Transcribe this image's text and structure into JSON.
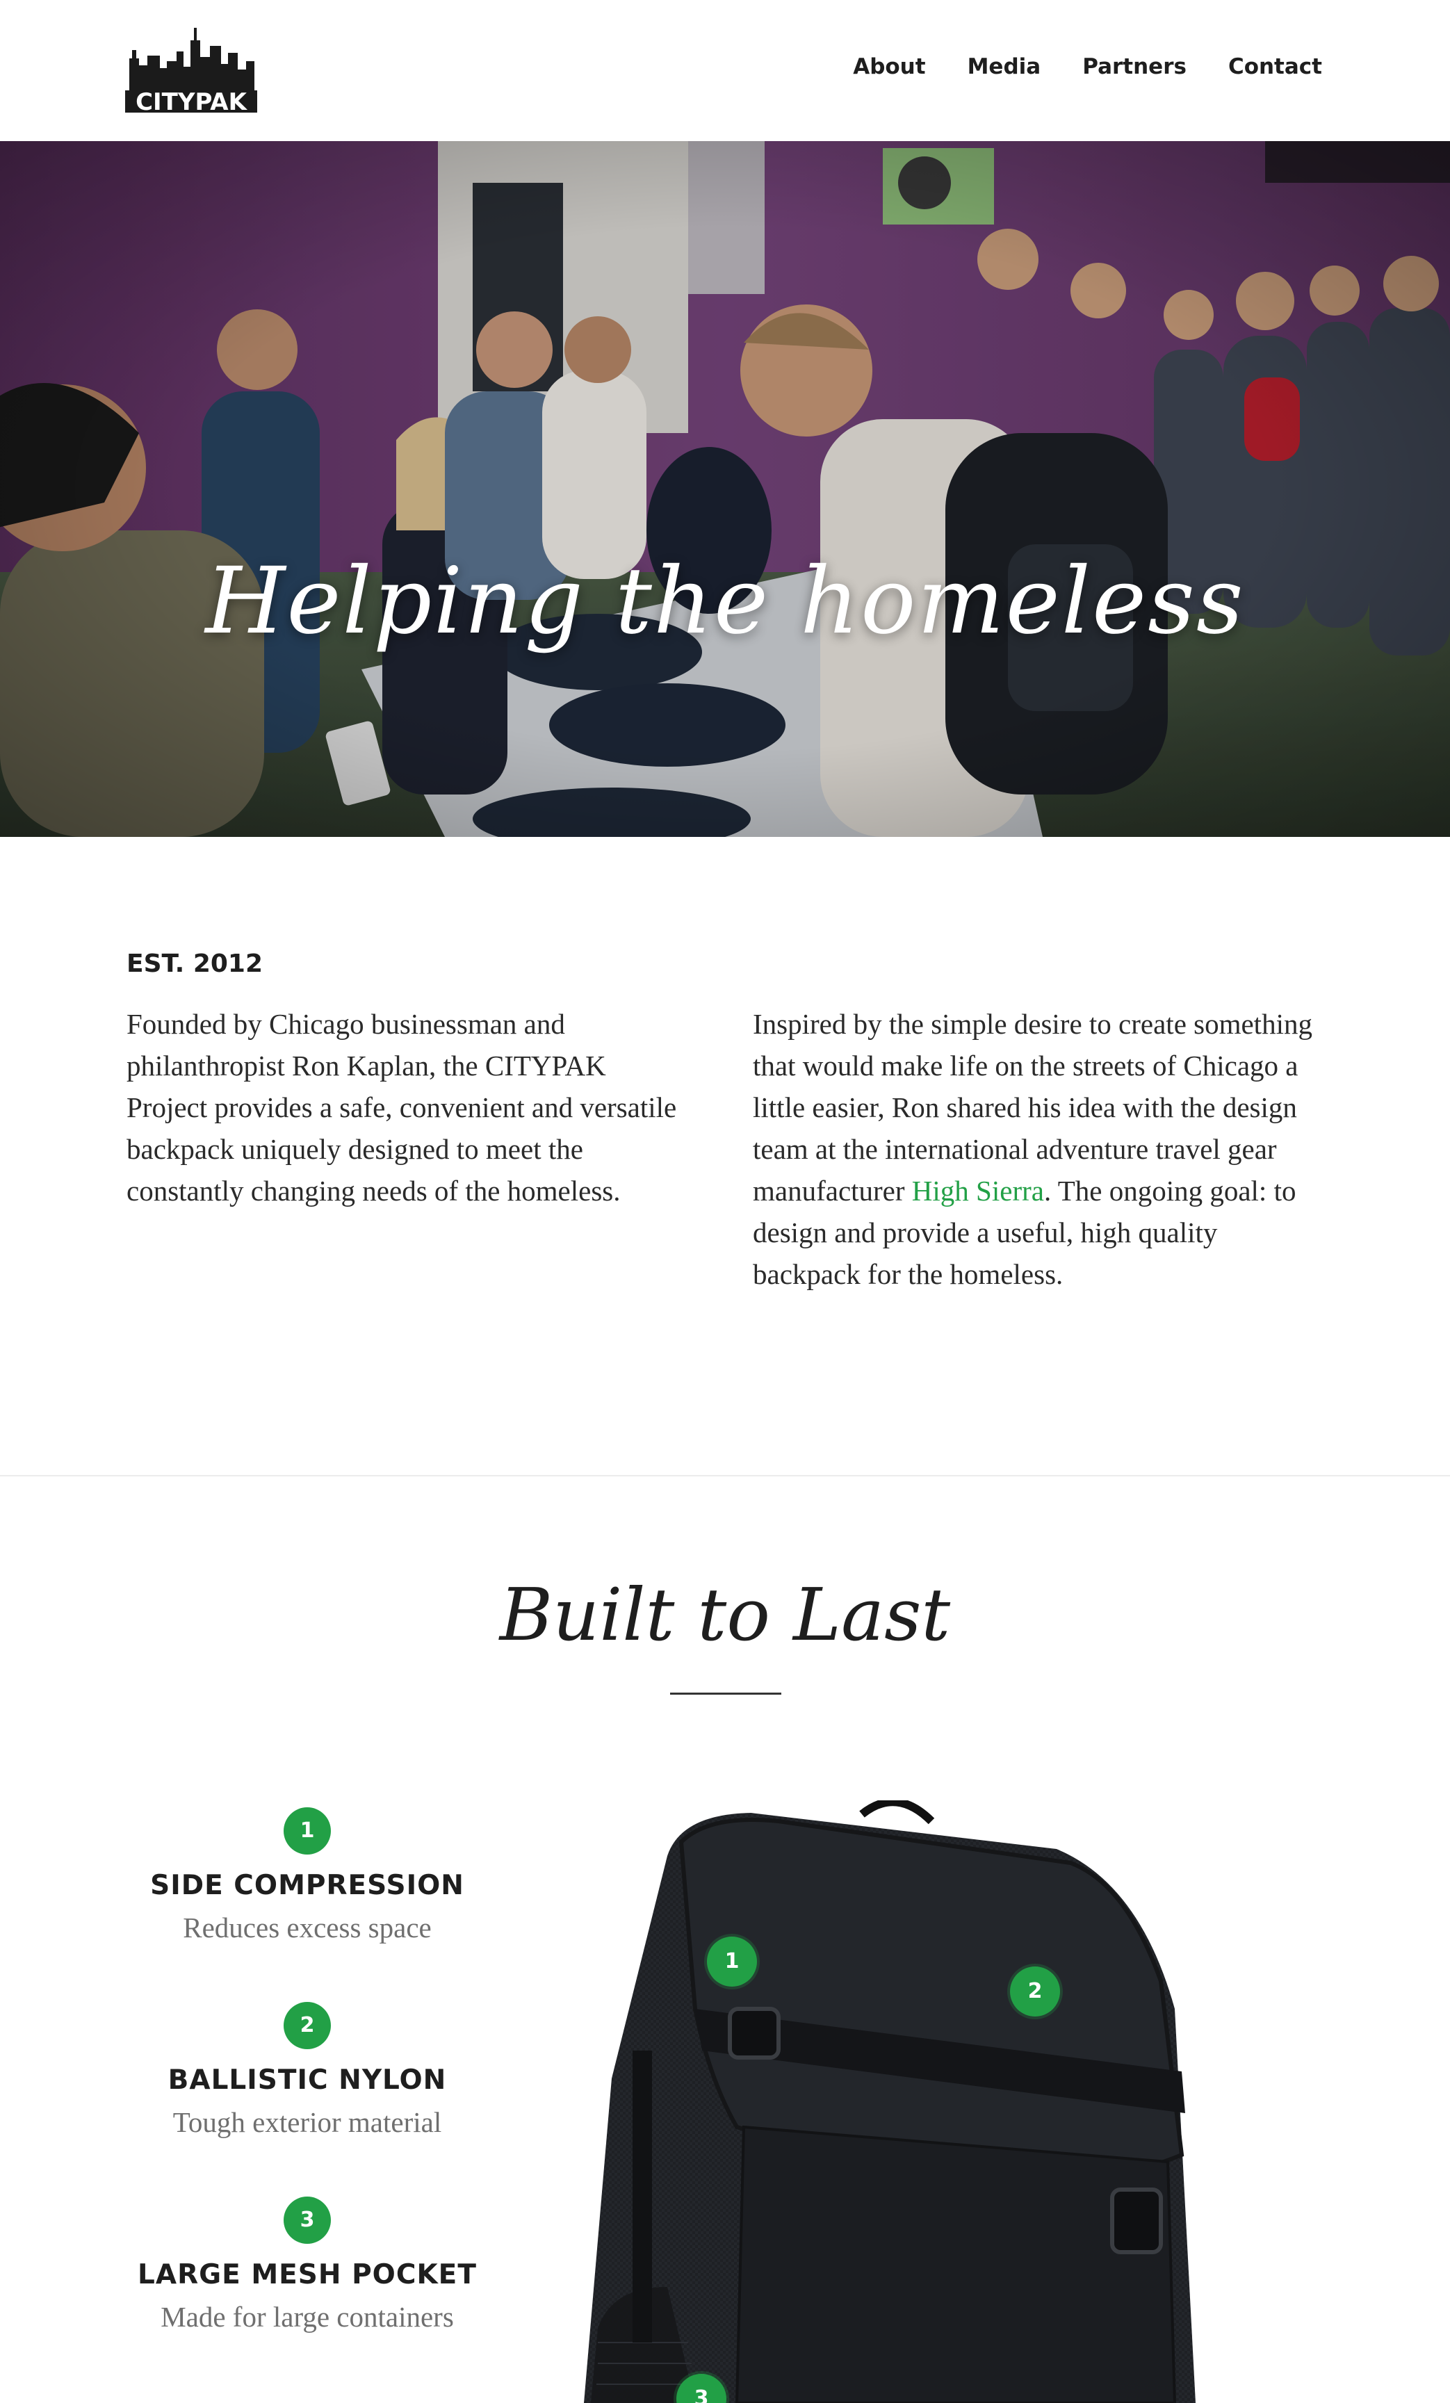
{
  "header": {
    "logo_text": "CITYPAK",
    "nav": [
      "About",
      "Media",
      "Partners",
      "Contact"
    ]
  },
  "hero": {
    "title": "Helping the homeless",
    "image": "photo of volunteers handing out backpacks to homeless people in a purple-walled room"
  },
  "intro": {
    "est": "EST. 2012",
    "left_paragraph": "Founded by Chicago businessman and philanthropist Ron Kaplan, the CITYPAK Project provides a safe, convenient and versatile backpack uniquely designed to meet the constantly changing needs of the homeless.",
    "right_before_link": "Inspired by the simple desire to create something that would make life on the streets of Chicago a little easier, Ron shared his idea with the design team at the international adventure travel gear manufacturer ",
    "right_link": "High Sierra",
    "right_after_link": ". The ongoing goal: to design and provide a useful, high quality backpack for the homeless."
  },
  "built": {
    "title": "Built to Last",
    "features": [
      {
        "num": "1",
        "title": "SIDE COMPRESSION",
        "desc": "Reduces excess space"
      },
      {
        "num": "2",
        "title": "BALLISTIC NYLON",
        "desc": "Tough exterior material"
      },
      {
        "num": "3",
        "title": "LARGE MESH POCKET",
        "desc": "Made for large containers"
      }
    ],
    "pins": [
      "1",
      "2",
      "3"
    ]
  },
  "colors": {
    "accent": "#22a046",
    "hero_wall": "#6b3a6e",
    "text": "#1e1e1e"
  }
}
